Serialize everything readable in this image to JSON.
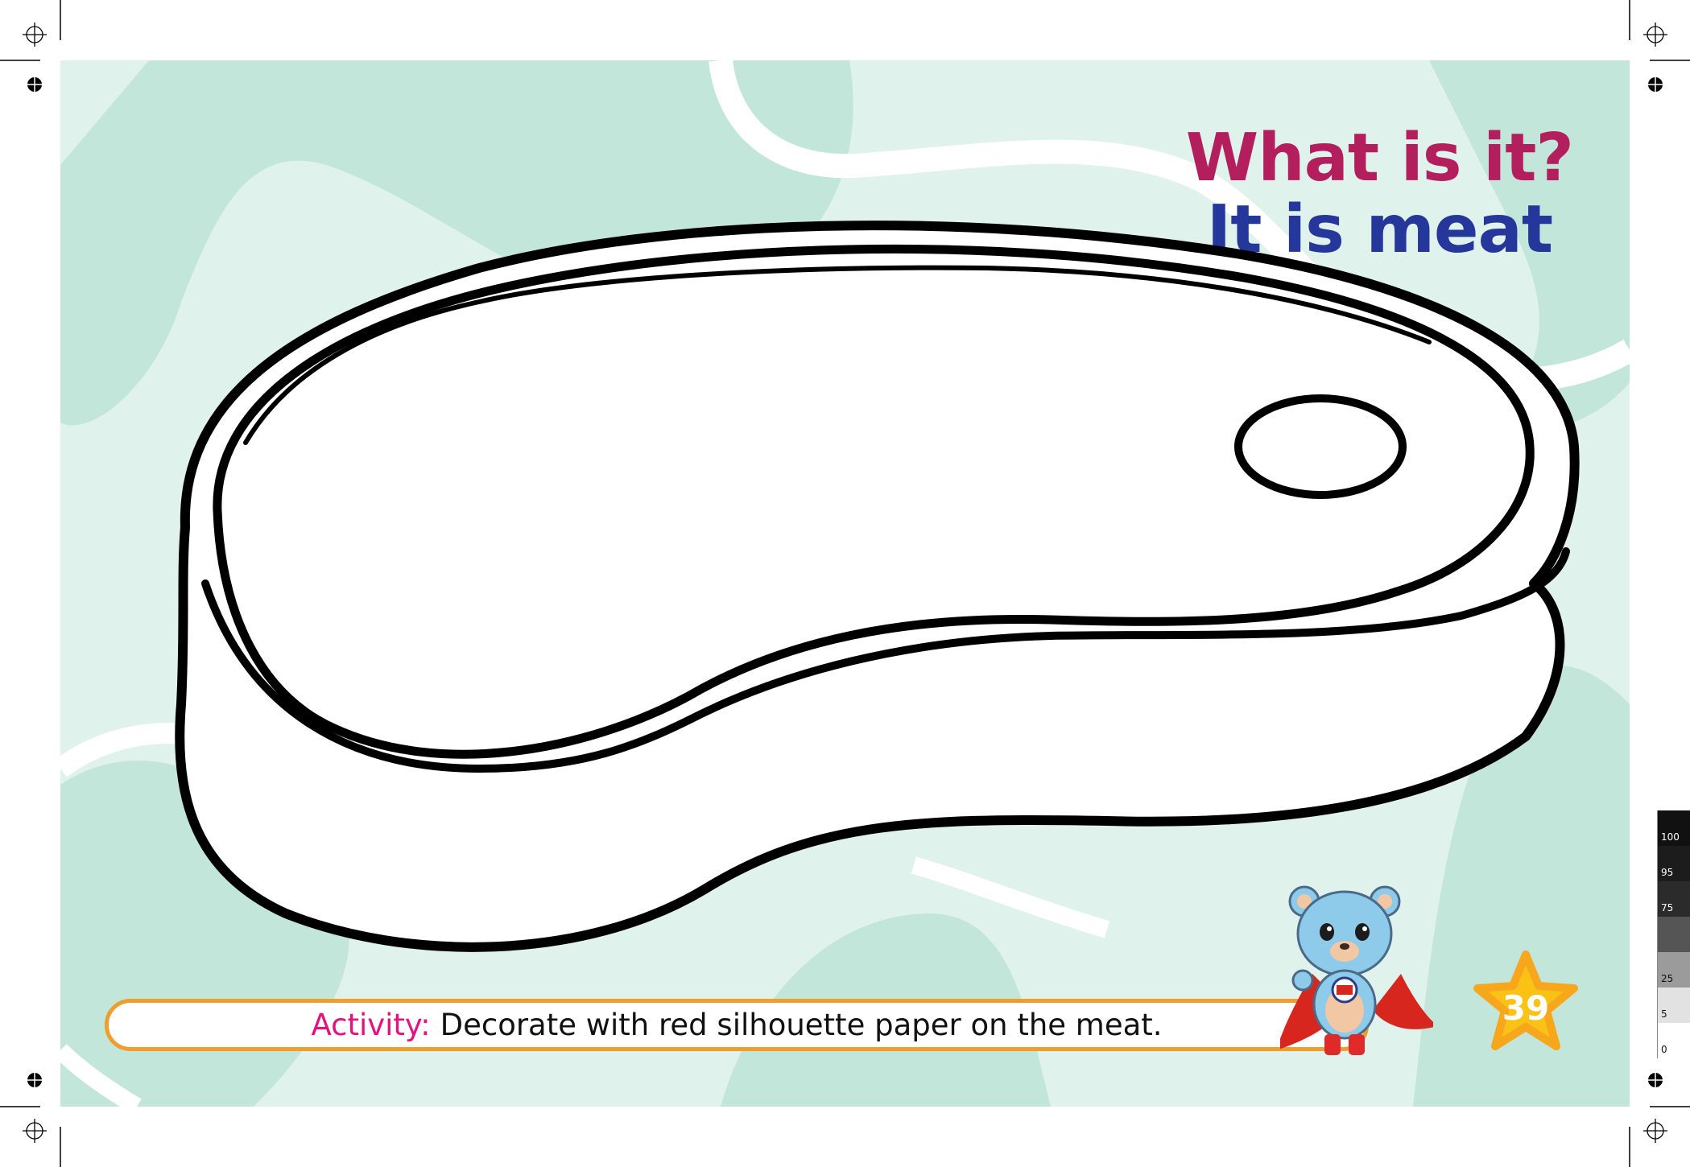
{
  "title": {
    "question": "What is it?",
    "answer": "It is meat"
  },
  "activity": {
    "label": "Activity:",
    "text": "Decorate with red silhouette paper on the meat."
  },
  "page_number": "39",
  "color_scale": [
    {
      "label": "100",
      "color": "#111111"
    },
    {
      "label": "95",
      "color": "#1c1c1c"
    },
    {
      "label": "75",
      "color": "#2b2b2b"
    },
    {
      "label": "",
      "color": "#555555"
    },
    {
      "label": "25",
      "color": "#9b9b9b"
    },
    {
      "label": "5",
      "color": "#e2e2e2"
    },
    {
      "label": "0",
      "color": "#ffffff"
    }
  ],
  "colors": {
    "background": "#e0f2ec",
    "blob": "#c3e6da",
    "question": "#b21f5c",
    "answer": "#25379a",
    "activity_label": "#e3127c",
    "activity_border": "#ef9d2d",
    "star": "#f9c214"
  },
  "icons": {
    "illustration": "meat-steak-outline",
    "mascot": "bear-superhero-icon",
    "badge": "star-icon",
    "registration": "crosshair-icon"
  }
}
